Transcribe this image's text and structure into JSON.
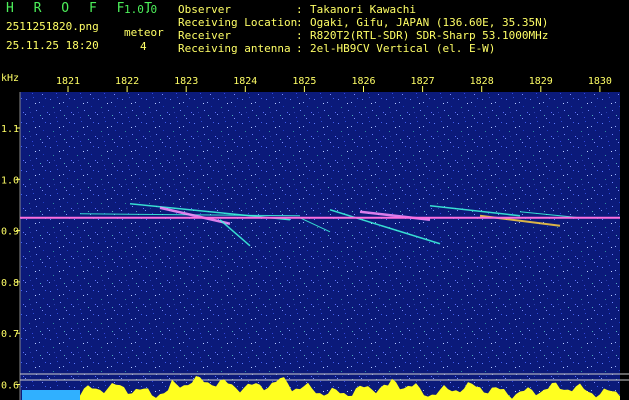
{
  "app": {
    "title": "H R O F F T",
    "version": "1.0.0"
  },
  "file": {
    "name": "2511251820.png",
    "timestamp": "25.11.25 18:20"
  },
  "detection": {
    "label": "meteor",
    "count": "4"
  },
  "meta": [
    {
      "key": "Observer",
      "value": "Takanori Kawachi"
    },
    {
      "key": "Receiving Location",
      "value": "Ogaki, Gifu, JAPAN (136.60E, 35.35N)"
    },
    {
      "key": "Receiver",
      "value": "R820T2(RTL-SDR) SDR-Sharp 53.1000MHz"
    },
    {
      "key": "Receiving antenna",
      "value": "2el-HB9CV Vertical (el. E-W)"
    }
  ],
  "chart_data": {
    "type": "heatmap",
    "ylabel": "kHz",
    "x_ticks": [
      "1821",
      "1822",
      "1823",
      "1824",
      "1825",
      "1826",
      "1827",
      "1828",
      "1829",
      "1830"
    ],
    "y_ticks": [
      "1.1",
      "1.0",
      "0.9",
      "0.8",
      "0.7",
      "0.6"
    ],
    "carrier_khz": 0.925,
    "colors": {
      "background": "#0b1a7a",
      "carrier": "#ff6fe0",
      "signal": "#ffff20",
      "trace": "#40ffe0"
    }
  }
}
